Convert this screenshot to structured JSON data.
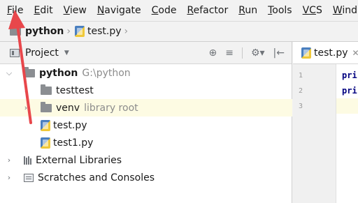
{
  "menubar": {
    "items": [
      {
        "mnemonic": "F",
        "rest": "ile"
      },
      {
        "mnemonic": "E",
        "rest": "dit"
      },
      {
        "mnemonic": "V",
        "rest": "iew"
      },
      {
        "mnemonic": "N",
        "rest": "avigate"
      },
      {
        "mnemonic": "C",
        "rest": "ode"
      },
      {
        "mnemonic": "R",
        "rest": "efactor"
      },
      {
        "mnemonic": "R",
        "rest": "un"
      },
      {
        "mnemonic": "T",
        "rest": "ools"
      },
      {
        "mnemonic": "VC",
        "rest": "S"
      },
      {
        "mnemonic": "W",
        "rest": "ind"
      }
    ]
  },
  "breadcrumb": {
    "project": "python",
    "file": "test.py"
  },
  "project_panel": {
    "title": "Project",
    "tree": {
      "root_name": "python",
      "root_path": "G:\\python",
      "items": [
        {
          "label": "testtest"
        },
        {
          "label": "venv",
          "hint": "library root"
        },
        {
          "label": "test.py"
        },
        {
          "label": "test1.py"
        }
      ],
      "external_libraries": "External Libraries",
      "scratches": "Scratches and Consoles"
    }
  },
  "editor": {
    "tab": "test.py",
    "line_numbers": [
      "1",
      "2",
      "3"
    ],
    "code_lines": [
      "pri",
      "pri"
    ]
  },
  "colors": {
    "annotation_arrow": "#e8474b",
    "highlight_row": "#fdfbe3"
  }
}
